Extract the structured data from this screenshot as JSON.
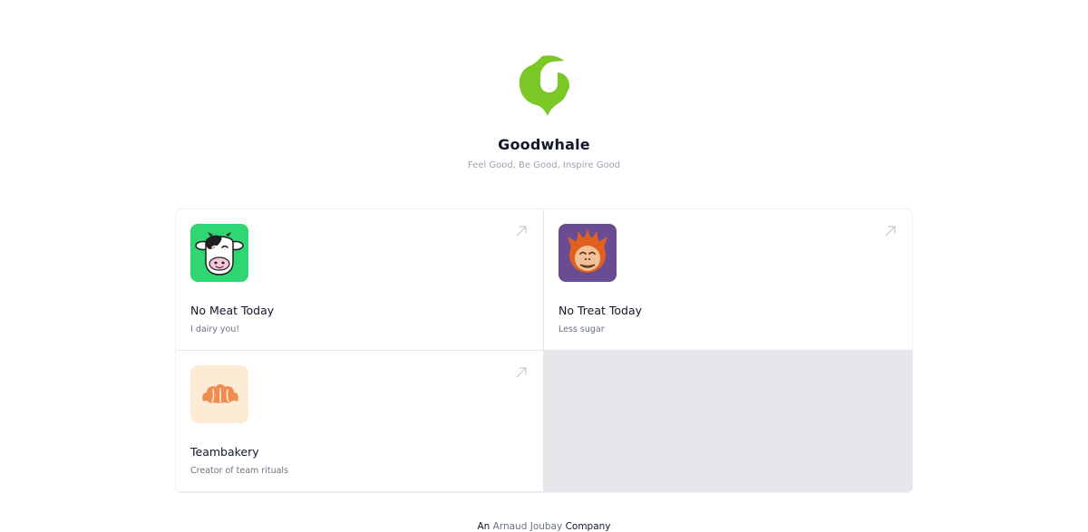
{
  "brand": {
    "title": "Goodwhale",
    "tagline": "Feel Good, Be Good, Inspire Good",
    "logo_icon": "goodwhale-logo-icon",
    "accent": "#7bc726"
  },
  "apps": [
    {
      "title": "No Meat Today",
      "description": "I dairy you!",
      "icon": "cow-icon",
      "icon_bg": "#2fd672"
    },
    {
      "title": "No Treat Today",
      "description": "Less sugar",
      "icon": "monkey-icon",
      "icon_bg": "#6a4c93"
    },
    {
      "title": "Teambakery",
      "description": "Creator of team rituals",
      "icon": "croissant-icon",
      "icon_bg": "#fdebd5"
    }
  ],
  "footer": {
    "prefix": "An",
    "link": "Arnaud Joubay",
    "suffix": "Company"
  }
}
